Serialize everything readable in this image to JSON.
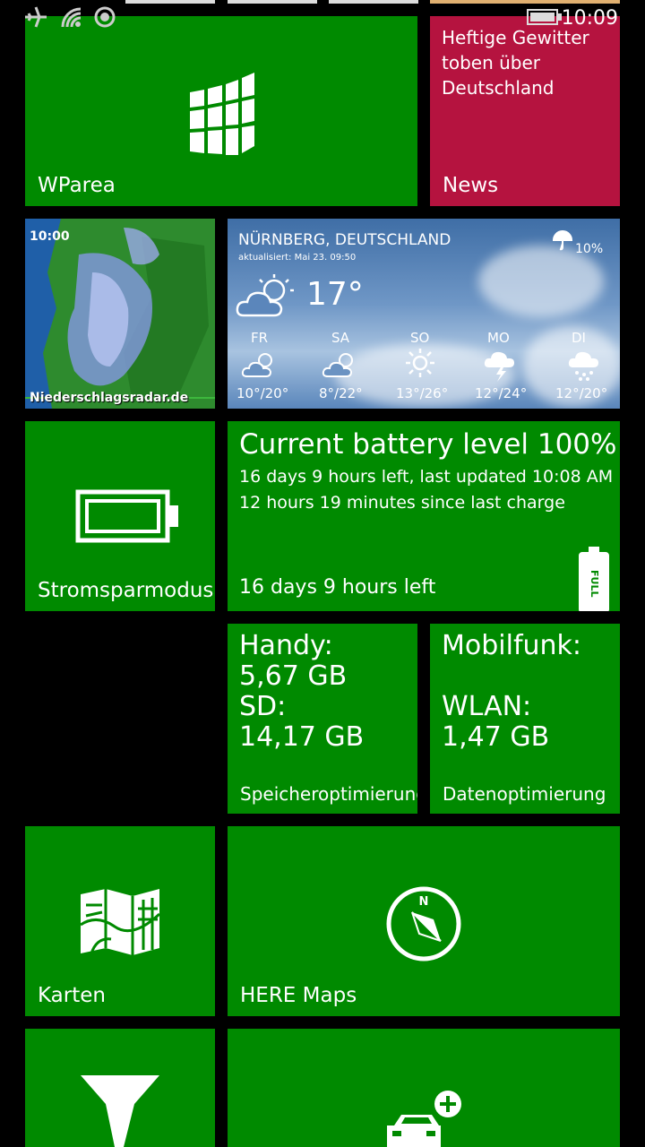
{
  "status_bar": {
    "time": "10:09",
    "icons": [
      "airplane-icon",
      "wifi-icon",
      "location-icon",
      "battery-icon"
    ]
  },
  "tiles": {
    "wparea": {
      "label": "WParea",
      "icon": "wparea-logo-icon"
    },
    "news": {
      "headline": "Heftige Gewitter toben über Deutschland",
      "label": "News"
    },
    "radar": {
      "time": "10:00",
      "source": "Niederschlagsradar.de"
    },
    "weather": {
      "location": "NÜRNBERG, DEUTSCHLAND",
      "updated": "aktualisiert: Mai 23. 09:50",
      "rain_chance": "10%",
      "current_temp": "17°",
      "forecast": [
        {
          "day": "FR",
          "temps": "10°/20°",
          "icon": "partly-cloudy-icon"
        },
        {
          "day": "SA",
          "temps": "8°/22°",
          "icon": "partly-cloudy-icon"
        },
        {
          "day": "SO",
          "temps": "13°/26°",
          "icon": "sun-icon"
        },
        {
          "day": "MO",
          "temps": "12°/24°",
          "icon": "thunderstorm-icon"
        },
        {
          "day": "DI",
          "temps": "12°/20°",
          "icon": "rain-icon"
        }
      ]
    },
    "stromsparmodus": {
      "label": "Stromsparmodus",
      "icon": "battery-icon"
    },
    "battery": {
      "title": "Current battery level 100%",
      "line1": "16 days 9 hours left, last updated 10:08 AM",
      "line2": "12 hours 19 minutes since last charge",
      "bottom": "16 days 9 hours left",
      "badge": "FULL"
    },
    "storage": {
      "l1": "Handy:",
      "l2": "5,67 GB",
      "l3": "SD:",
      "l4": "14,17 GB",
      "label": "Speicheroptimierung"
    },
    "data": {
      "l1": "Mobilfunk:",
      "l2": "WLAN:",
      "l3": "1,47 GB",
      "label": "Datenoptimierung"
    },
    "karten": {
      "label": "Karten",
      "icon": "map-icon"
    },
    "here_maps": {
      "label": "HERE Maps",
      "icon": "compass-icon"
    },
    "here_drive": {
      "icon": "navigation-arrow-icon"
    },
    "car": {
      "icon": "car-add-icon"
    }
  },
  "colors": {
    "tile_green": "#008a00",
    "news_red": "#b5133f",
    "background": "#000000"
  }
}
